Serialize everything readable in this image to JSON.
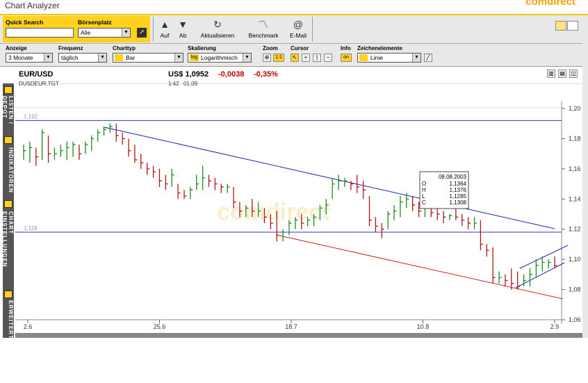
{
  "window": {
    "title": "Chart Analyzer",
    "brand": "comdirect"
  },
  "toolbar": {
    "quick_search_label": "Quick Search",
    "quick_search_value": "",
    "boersenplatz_label": "Börsenplatz",
    "boersenplatz_value": "Alle",
    "buttons": [
      {
        "label": "Auf",
        "icon": "arrow-up-icon"
      },
      {
        "label": "Ab",
        "icon": "arrow-down-icon"
      },
      {
        "label": "Aktualisieren",
        "icon": "refresh-icon"
      },
      {
        "label": "Benchmark",
        "icon": "benchmark-icon"
      },
      {
        "label": "E-Mail",
        "icon": "email-icon"
      }
    ]
  },
  "settings": {
    "anzeige_label": "Anzeige",
    "anzeige_value": "3 Monate",
    "frequenz_label": "Frequenz",
    "frequenz_value": "täglich",
    "charttyp_label": "Charttyp",
    "charttyp_value": "Bar",
    "skalierung_label": "Skalierung",
    "skalierung_value": "Logarithmisch",
    "skalierung_badge": "log",
    "zoom_label": "Zoom",
    "zoom_value": "1:1",
    "cursor_label": "Cursor",
    "info_label": "Info",
    "info_value": "on",
    "zeichen_label": "Zeichenelemente",
    "zeichen_value": "Linie"
  },
  "instrument": {
    "name": "EUR/USD",
    "code": "DUSDEUR.TGT",
    "price": "US$ 1,0952",
    "change": "-0,0038",
    "change_pct": "-0,35%",
    "time": "1:42",
    "date": "01.09"
  },
  "sidebar": {
    "items": [
      "LISTEN / DEPOT",
      "INDIKATOREN",
      "CHART EINSTELLUNGEN",
      "ERWEITERT"
    ]
  },
  "chart_data": {
    "type": "bar",
    "x_ticks": [
      "2.6",
      "25.6",
      "18.7",
      "10.8",
      "2.9"
    ],
    "y_ticks": [
      "1,20",
      "1,18",
      "1,16",
      "1,14",
      "1,12",
      "1,10",
      "1,08",
      "1,06"
    ],
    "ylim": [
      1.06,
      1.2
    ],
    "hlines": [
      {
        "value": 1.192,
        "label": "1,192"
      },
      {
        "value": 1.118,
        "label": "1,118"
      }
    ],
    "watermark": "comdirect",
    "info_box": {
      "date": "08.08.2003",
      "rows": [
        [
          "O",
          "1,1364"
        ],
        [
          "H",
          "1,1376"
        ],
        [
          "L",
          "1,1285"
        ],
        [
          "C",
          "1,1308"
        ]
      ]
    },
    "bars": [
      [
        1.176,
        1.166,
        1.172
      ],
      [
        1.178,
        1.164,
        1.174
      ],
      [
        1.174,
        1.162,
        1.168
      ],
      [
        1.186,
        1.166,
        1.184
      ],
      [
        1.182,
        1.164,
        1.17
      ],
      [
        1.174,
        1.166,
        1.17
      ],
      [
        1.176,
        1.168,
        1.172
      ],
      [
        1.178,
        1.166,
        1.174
      ],
      [
        1.178,
        1.168,
        1.176
      ],
      [
        1.176,
        1.166,
        1.17
      ],
      [
        1.178,
        1.17,
        1.176
      ],
      [
        1.182,
        1.172,
        1.18
      ],
      [
        1.186,
        1.178,
        1.184
      ],
      [
        1.188,
        1.182,
        1.186
      ],
      [
        1.19,
        1.184,
        1.188
      ],
      [
        1.19,
        1.178,
        1.182
      ],
      [
        1.184,
        1.176,
        1.18
      ],
      [
        1.18,
        1.168,
        1.172
      ],
      [
        1.176,
        1.164,
        1.166
      ],
      [
        1.17,
        1.16,
        1.164
      ],
      [
        1.164,
        1.156,
        1.16
      ],
      [
        1.162,
        1.154,
        1.158
      ],
      [
        1.16,
        1.148,
        1.152
      ],
      [
        1.156,
        1.146,
        1.15
      ],
      [
        1.16,
        1.148,
        1.156
      ],
      [
        1.15,
        1.14,
        1.144
      ],
      [
        1.146,
        1.14,
        1.142
      ],
      [
        1.148,
        1.14,
        1.146
      ],
      [
        1.156,
        1.146,
        1.15
      ],
      [
        1.162,
        1.146,
        1.154
      ],
      [
        1.156,
        1.148,
        1.152
      ],
      [
        1.154,
        1.146,
        1.15
      ],
      [
        1.15,
        1.144,
        1.148
      ],
      [
        1.15,
        1.144,
        1.148
      ],
      [
        1.148,
        1.134,
        1.138
      ],
      [
        1.138,
        1.128,
        1.132
      ],
      [
        1.136,
        1.128,
        1.134
      ],
      [
        1.14,
        1.128,
        1.132
      ],
      [
        1.138,
        1.128,
        1.132
      ],
      [
        1.134,
        1.124,
        1.128
      ],
      [
        1.13,
        1.12,
        1.124
      ],
      [
        1.132,
        1.112,
        1.116
      ],
      [
        1.12,
        1.112,
        1.118
      ],
      [
        1.126,
        1.116,
        1.124
      ],
      [
        1.128,
        1.12,
        1.126
      ],
      [
        1.13,
        1.12,
        1.124
      ],
      [
        1.128,
        1.122,
        1.126
      ],
      [
        1.13,
        1.122,
        1.128
      ],
      [
        1.136,
        1.126,
        1.134
      ],
      [
        1.14,
        1.13,
        1.136
      ],
      [
        1.154,
        1.14,
        1.15
      ],
      [
        1.156,
        1.146,
        1.152
      ],
      [
        1.154,
        1.148,
        1.152
      ],
      [
        1.152,
        1.146,
        1.15
      ],
      [
        1.156,
        1.144,
        1.148
      ],
      [
        1.152,
        1.14,
        1.146
      ],
      [
        1.142,
        1.122,
        1.126
      ],
      [
        1.128,
        1.118,
        1.122
      ],
      [
        1.124,
        1.114,
        1.12
      ],
      [
        1.132,
        1.12,
        1.13
      ],
      [
        1.136,
        1.126,
        1.132
      ],
      [
        1.142,
        1.128,
        1.138
      ],
      [
        1.144,
        1.134,
        1.14
      ],
      [
        1.142,
        1.132,
        1.136
      ],
      [
        1.138,
        1.128,
        1.132
      ],
      [
        1.136,
        1.128,
        1.134
      ],
      [
        1.138,
        1.128,
        1.131
      ],
      [
        1.134,
        1.126,
        1.13
      ],
      [
        1.132,
        1.124,
        1.128
      ],
      [
        1.13,
        1.126,
        1.129
      ],
      [
        1.134,
        1.126,
        1.128
      ],
      [
        1.13,
        1.122,
        1.126
      ],
      [
        1.128,
        1.12,
        1.124
      ],
      [
        1.128,
        1.12,
        1.124
      ],
      [
        1.126,
        1.106,
        1.11
      ],
      [
        1.11,
        1.102,
        1.106
      ],
      [
        1.108,
        1.084,
        1.088
      ],
      [
        1.092,
        1.084,
        1.088
      ],
      [
        1.09,
        1.082,
        1.086
      ],
      [
        1.094,
        1.08,
        1.084
      ],
      [
        1.092,
        1.08,
        1.082
      ],
      [
        1.09,
        1.082,
        1.086
      ],
      [
        1.094,
        1.082,
        1.09
      ],
      [
        1.1,
        1.088,
        1.096
      ],
      [
        1.102,
        1.092,
        1.098
      ],
      [
        1.1,
        1.094,
        1.098
      ],
      [
        1.102,
        1.094,
        1.096
      ]
    ]
  }
}
